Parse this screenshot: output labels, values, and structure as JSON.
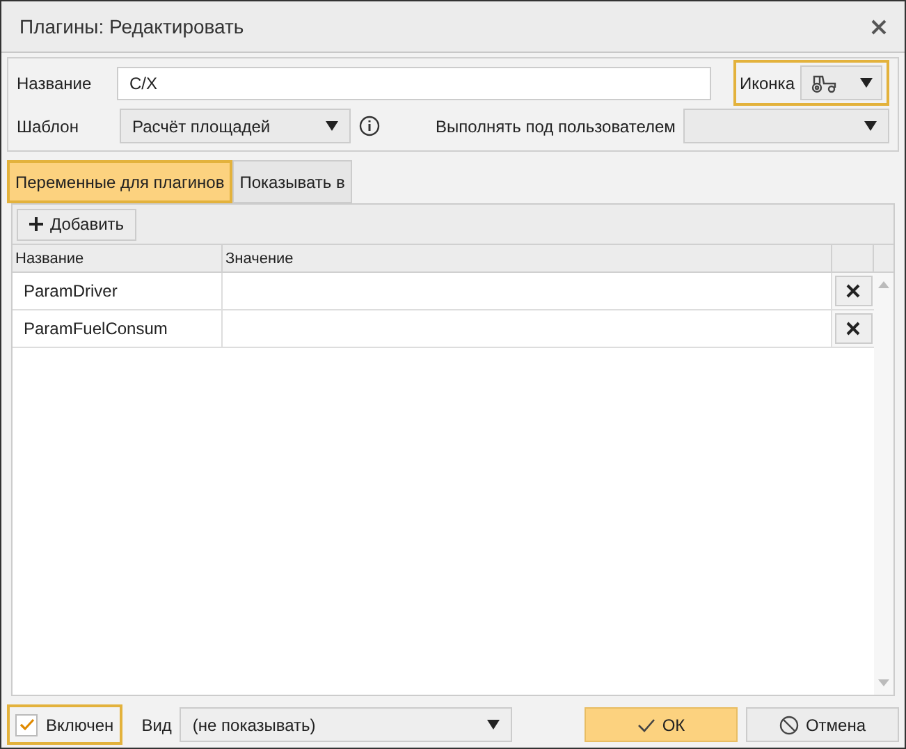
{
  "window": {
    "title": "Плагины: Редактировать"
  },
  "form": {
    "name": {
      "label": "Название",
      "value": "C/X"
    },
    "icon": {
      "label": "Иконка",
      "highlighted": true
    },
    "template": {
      "label": "Шаблон",
      "value": "Расчёт площадей"
    },
    "run_as": {
      "label": "Выполнять под пользователем"
    }
  },
  "tabs": [
    {
      "label": "Переменные для плагинов",
      "selected": true
    },
    {
      "label": "Показывать в",
      "selected": false
    }
  ],
  "toolbar": {
    "add_button": "Добавить"
  },
  "table": {
    "columns": [
      "Название",
      "Значение"
    ],
    "rows": [
      {
        "name": "ParamDriver"
      },
      {
        "name": "ParamFuelConsum"
      }
    ]
  },
  "footer": {
    "enabled": {
      "label": "Включен",
      "checked": true,
      "highlighted": true
    },
    "view": {
      "label": "Вид",
      "value": "(не показывать)"
    },
    "ok": "ОК",
    "cancel": "Отмена"
  }
}
